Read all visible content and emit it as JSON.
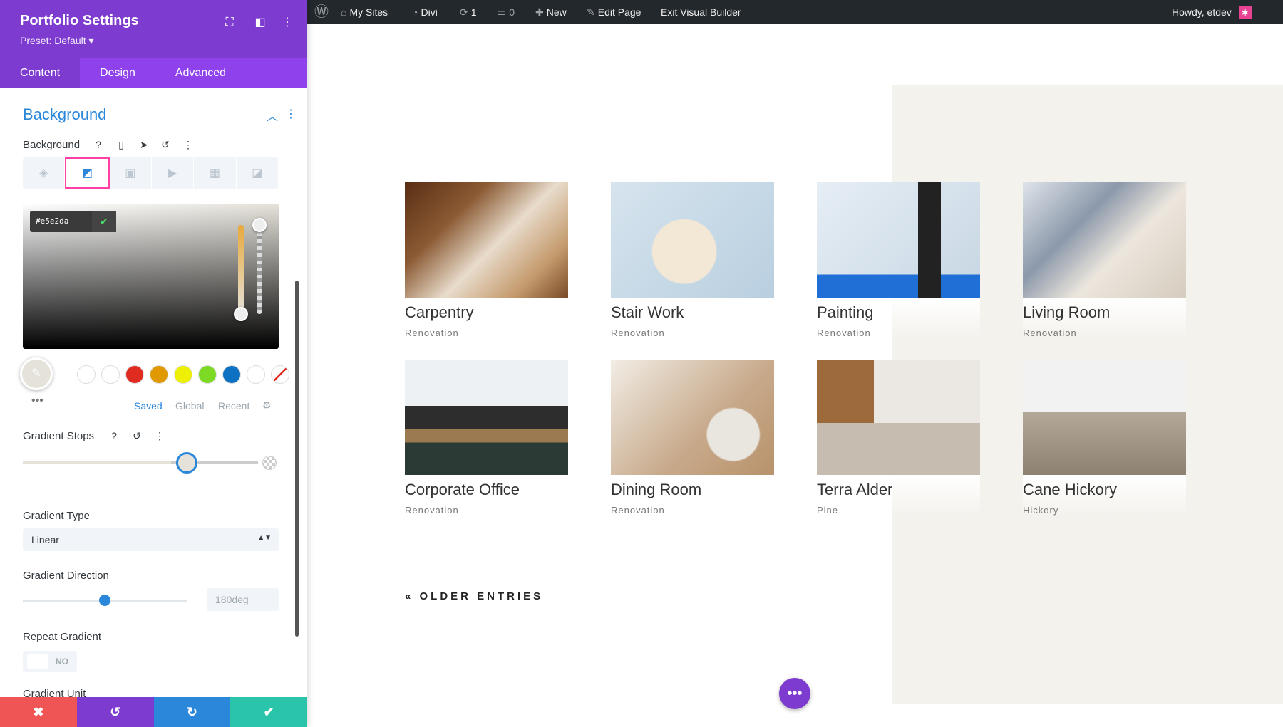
{
  "panel": {
    "title": "Portfolio Settings",
    "preset": "Preset: Default ▾",
    "tabs": [
      "Content",
      "Design",
      "Advanced"
    ],
    "section_title": "Background",
    "background_label": "Background",
    "picker": {
      "hex": "#e5e2da"
    },
    "swatch_tabs": [
      "Saved",
      "Global",
      "Recent"
    ],
    "swatch_colors": [
      "#ffffff",
      "#ffffff",
      "#e02b20",
      "#e09900",
      "#edf000",
      "#7cda24",
      "#0c71c3",
      "#ffffff"
    ],
    "gradient_stops_label": "Gradient Stops",
    "gradient_type_label": "Gradient Type",
    "gradient_type_value": "Linear",
    "gradient_direction_label": "Gradient Direction",
    "gradient_direction_value": "180deg",
    "gradient_direction_level": 0.5,
    "gradient_stops_level": 0.63,
    "repeat_label": "Repeat Gradient",
    "repeat_value": "NO",
    "cut_label": "Gradient Unit",
    "footer_colors": [
      "#ef5555",
      "#7e3bd0",
      "#2b87da",
      "#29c4a9"
    ]
  },
  "adminbar": {
    "my_sites": "My Sites",
    "divi": "Divi",
    "updates": "1",
    "comments": "0",
    "new": "New",
    "edit_page": "Edit Page",
    "exit_vb": "Exit Visual Builder",
    "howdy": "Howdy, etdev"
  },
  "portfolio": {
    "items": [
      {
        "title": "Carpentry",
        "category": "Renovation"
      },
      {
        "title": "Stair Work",
        "category": "Renovation"
      },
      {
        "title": "Painting",
        "category": "Renovation"
      },
      {
        "title": "Living Room",
        "category": "Renovation"
      },
      {
        "title": "Corporate Office",
        "category": "Renovation"
      },
      {
        "title": "Dining Room",
        "category": "Renovation"
      },
      {
        "title": "Terra Alder",
        "category": "Pine"
      },
      {
        "title": "Cane Hickory",
        "category": "Hickory"
      }
    ],
    "older_entries": "« OLDER ENTRIES"
  },
  "colors": {
    "accent": "#7e3bd0",
    "link": "#2b87da",
    "beige": "#f4f2ed"
  }
}
